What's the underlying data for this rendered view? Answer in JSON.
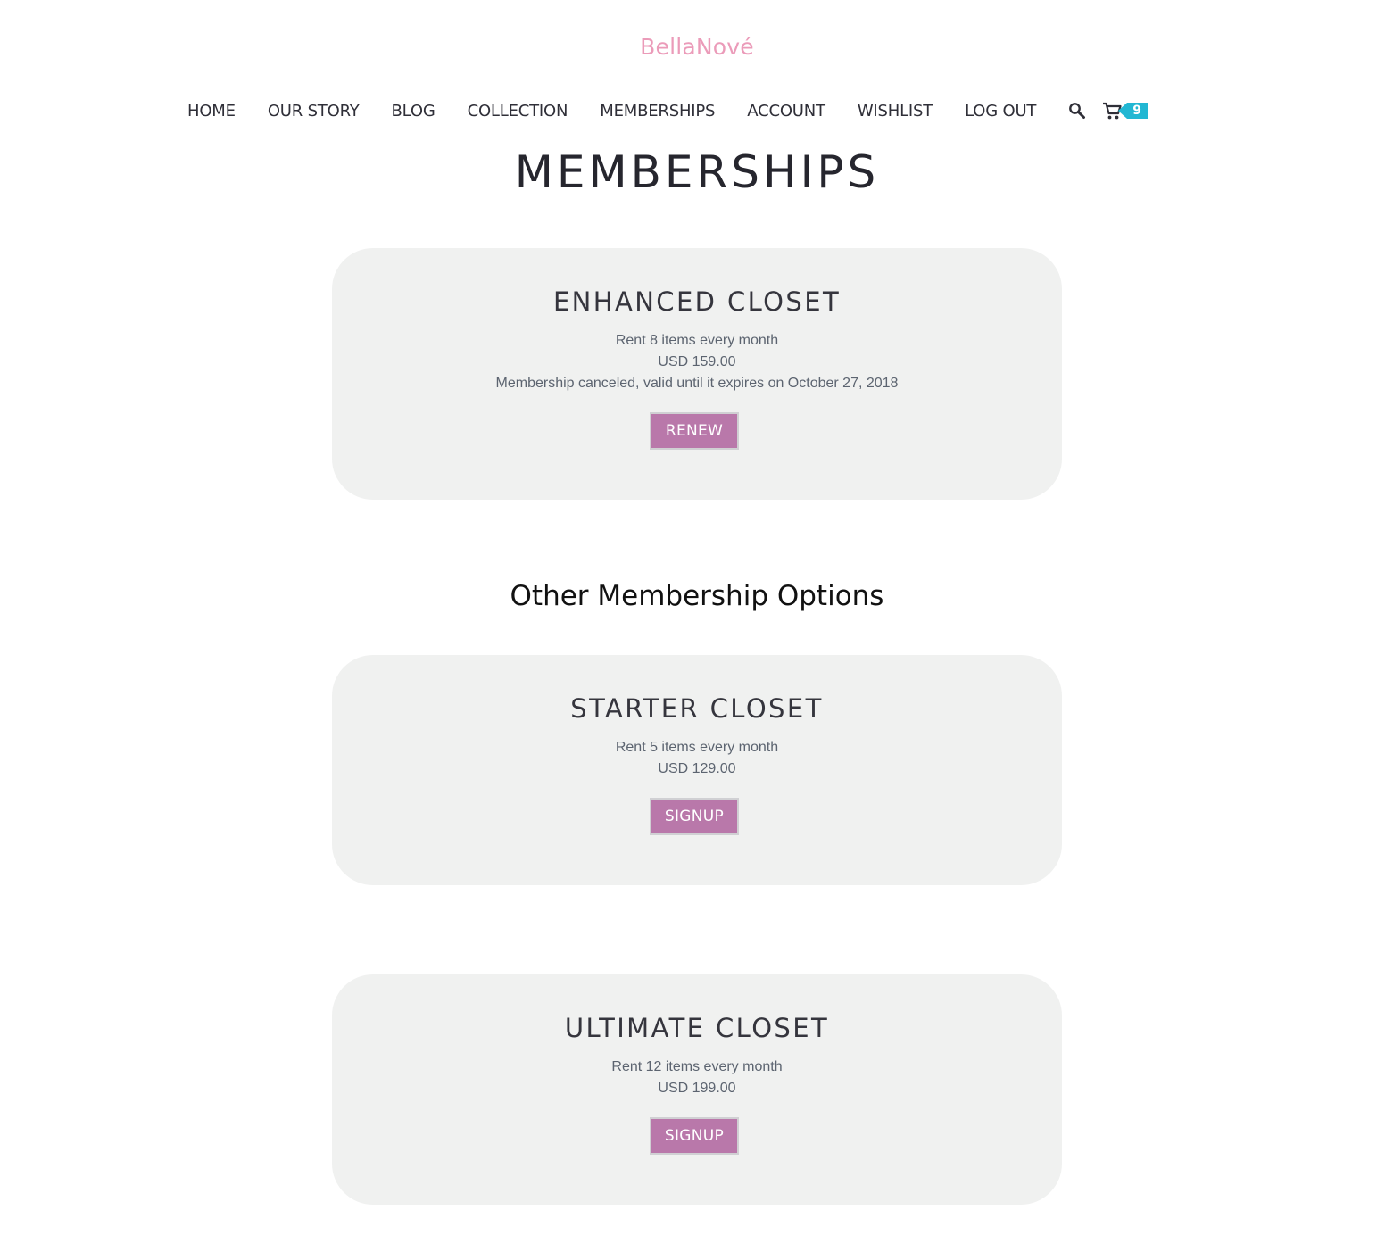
{
  "site": {
    "logo": "BellaNové"
  },
  "nav": {
    "items": [
      {
        "label": "HOME"
      },
      {
        "label": "OUR STORY"
      },
      {
        "label": "BLOG"
      },
      {
        "label": "COLLECTION"
      },
      {
        "label": "MEMBERSHIPS"
      },
      {
        "label": "ACCOUNT"
      },
      {
        "label": "WISHLIST"
      },
      {
        "label": "LOG OUT"
      }
    ],
    "search_icon": "search-icon",
    "cart_icon": "cart-icon",
    "cart_count": "9",
    "badge_color": "#22b7d3"
  },
  "page": {
    "title": "MEMBERSHIPS"
  },
  "current_membership": {
    "title": "ENHANCED CLOSET",
    "description": "Rent 8 items every month",
    "price": "USD 159.00",
    "status": "Membership canceled, valid until it expires on October 27, 2018",
    "button_label": "RENEW"
  },
  "other_heading": "Other Membership Options",
  "options": [
    {
      "title": "STARTER CLOSET",
      "description": "Rent 5 items every month",
      "price": "USD 129.00",
      "button_label": "SIGNUP"
    },
    {
      "title": "ULTIMATE CLOSET",
      "description": "Rent 12 items every month",
      "price": "USD 199.00",
      "button_label": "SIGNUP"
    }
  ],
  "colors": {
    "logo": "#eb9bb9",
    "button": "#b978aa",
    "card_background": "#f0f1f0"
  }
}
